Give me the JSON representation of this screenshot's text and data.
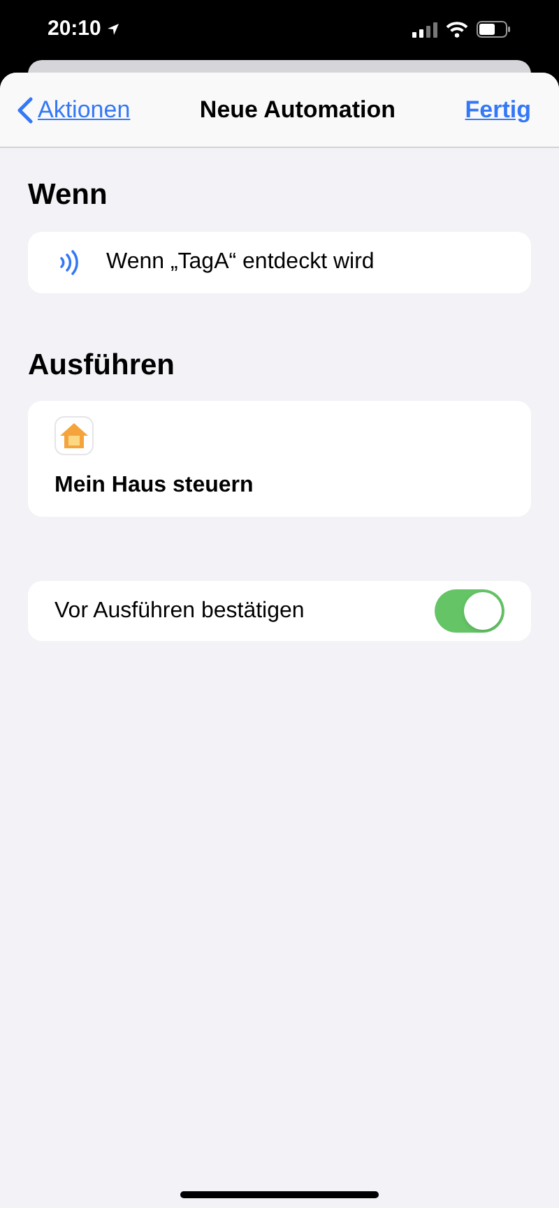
{
  "status_bar": {
    "time": "20:10"
  },
  "nav": {
    "back": "Aktionen",
    "title": "Neue Automation",
    "done": "Fertig"
  },
  "trigger": {
    "heading": "Wenn",
    "text": "Wenn „TagA“ entdeckt wird"
  },
  "action": {
    "heading": "Ausführen",
    "text": "Mein Haus steuern"
  },
  "confirm": {
    "label": "Vor Ausführen bestätigen",
    "on": true
  }
}
